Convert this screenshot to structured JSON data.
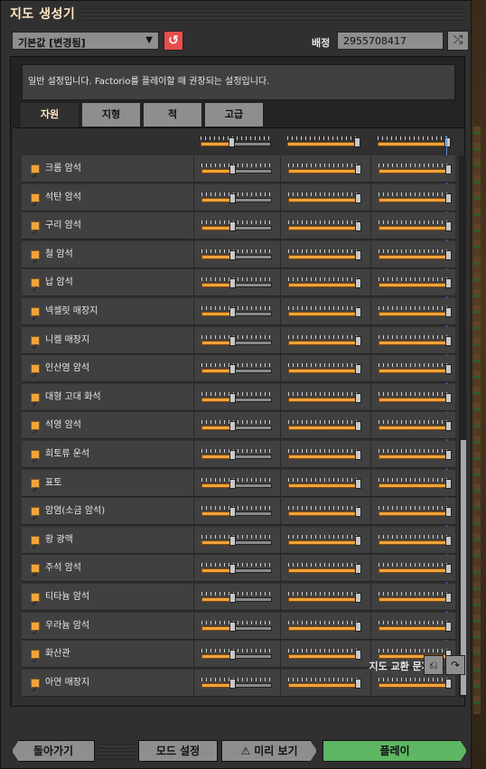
{
  "window": {
    "title": "지도 생성기"
  },
  "controls": {
    "preset_value": "기본값 [변경됨]",
    "seed_label": "배정",
    "seed_value": "2955708417"
  },
  "description": "일반 설정입니다. Factorio를 플레이할 때 권장되는 설정입니다.",
  "tabs": [
    {
      "label": "자원",
      "active": true
    },
    {
      "label": "지형",
      "active": false
    },
    {
      "label": "적",
      "active": false
    },
    {
      "label": "고급",
      "active": false
    }
  ],
  "resources": [
    {
      "name": "크롬 암석",
      "checked": true
    },
    {
      "name": "석탄 암석",
      "checked": true
    },
    {
      "name": "구리 암석",
      "checked": true
    },
    {
      "name": "철 암석",
      "checked": true
    },
    {
      "name": "납 암석",
      "checked": true
    },
    {
      "name": "넥셀릿 매장지",
      "checked": true
    },
    {
      "name": "니켈 매장지",
      "checked": true
    },
    {
      "name": "인산염 암석",
      "checked": true
    },
    {
      "name": "대형 고대 화석",
      "checked": true
    },
    {
      "name": "석영 암석",
      "checked": true
    },
    {
      "name": "희토류 운석",
      "checked": true
    },
    {
      "name": "표토",
      "checked": true
    },
    {
      "name": "암염(소금 암석)",
      "checked": true
    },
    {
      "name": "황 광맥",
      "checked": true
    },
    {
      "name": "주석 암석",
      "checked": true
    },
    {
      "name": "티타늄 암석",
      "checked": true
    },
    {
      "name": "우라늄 암석",
      "checked": true
    },
    {
      "name": "화산관",
      "checked": true
    },
    {
      "name": "아연 매장지",
      "checked": true
    }
  ],
  "slider_levels": {
    "frequency": 0.45,
    "size": 1.0,
    "richness": 1.0
  },
  "footer": {
    "exchange_label": "지도 교환 문자열",
    "back_label": "돌아가기",
    "mods_label": "모드 설정",
    "preview_label": "미리 보기",
    "play_label": "플레이"
  },
  "colors": {
    "accent_orange": "#f2a33a",
    "reset_red": "#e64d4d",
    "play_green": "#5eb663",
    "blue_marker": "#5a7fc9"
  }
}
